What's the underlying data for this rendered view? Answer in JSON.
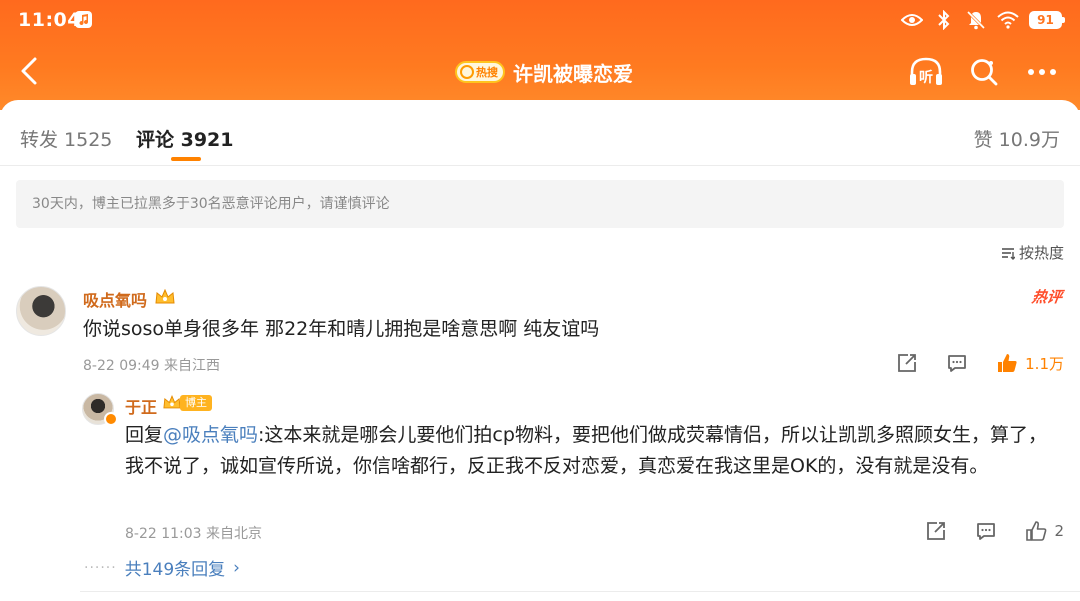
{
  "status_bar": {
    "time": "11:04",
    "battery": "91",
    "icons": [
      "music-app-icon",
      "eye-icon",
      "bluetooth-icon",
      "mute-bell-icon",
      "wifi-icon",
      "battery-icon"
    ]
  },
  "navbar": {
    "hot_badge": "热搜",
    "title": "许凯被曝恋爱",
    "listen_label": "听",
    "icons": [
      "back-chevron-icon",
      "listen-headphones-icon",
      "search-icon",
      "more-dots-icon"
    ]
  },
  "tabs": {
    "repost": "转发 1525",
    "comment": "评论 3921",
    "like": "赞 10.9万"
  },
  "notice": "30天内，博主已拉黑多于30名恶意评论用户，请谨慎评论",
  "sort_label": "按热度",
  "comment": {
    "username": "吸点氧吗",
    "badge": "热评",
    "text": "你说soso单身很多年 那22年和晴儿拥抱是啥意思啊 纯友谊吗",
    "meta": "8-22 09:49 来自江西",
    "likes": "1.1万"
  },
  "reply": {
    "username": "于正",
    "tag": "博主",
    "prefix": "回复",
    "mention": "@吸点氧吗",
    "text": ":这本来就是哪会儿要他们拍cp物料，要把他们做成荧幕情侣，所以让凯凯多照顾女生，算了，我不说了，诚如宣传所说，你信啥都行，反正我不反对恋爱，真恋爱在我这里是OK的，没有就是没有。",
    "meta": "8-22 11:03 来自北京",
    "likes": "2"
  },
  "more_replies": {
    "dots": "······",
    "label": "共149条回复",
    "chevron": "›"
  },
  "colors": {
    "header_orange": "#ff7a20",
    "username": "#d06a1c",
    "link_blue": "#4a7fbd",
    "accent_orange": "#ff8200"
  }
}
